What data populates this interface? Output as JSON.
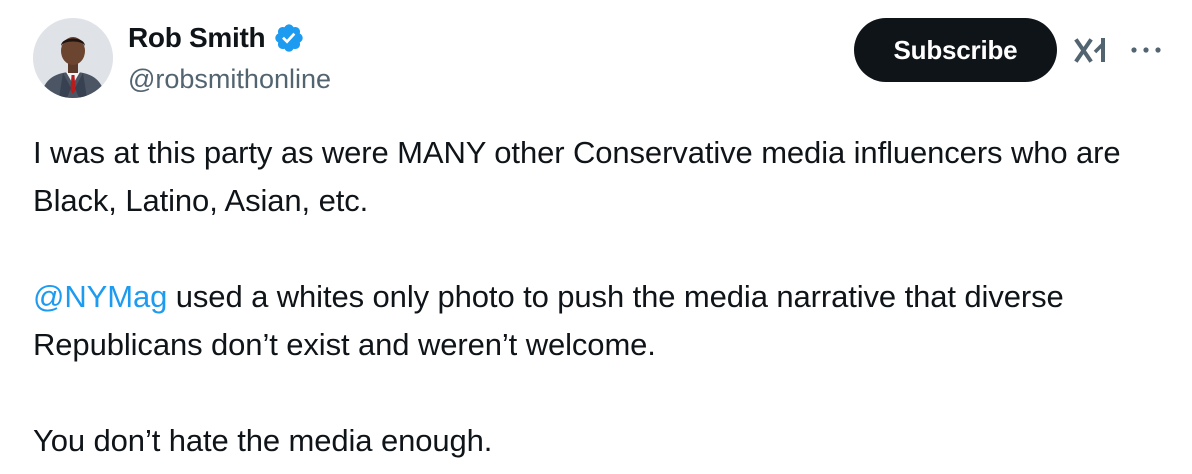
{
  "author": {
    "display_name": "Rob Smith",
    "handle": "@robsmithonline",
    "verified": true,
    "avatar_icon": "profile-photo",
    "verified_icon": "verified-badge-icon",
    "verified_color": "#1d9bf0"
  },
  "actions": {
    "subscribe_label": "Subscribe",
    "grok_icon": "grok-icon",
    "more_icon": "more-options-icon"
  },
  "tweet": {
    "paragraph_1": "I was at this party as were MANY other Conservative media influencers who are Black, Latino, Asian, etc.",
    "mention": "@NYMag",
    "paragraph_2_rest": " used a whites only photo to push the media narrative that diverse Republicans don’t exist and weren’t welcome.",
    "paragraph_3": "You don’t hate the media enough."
  },
  "colors": {
    "text": "#0f1419",
    "secondary_text": "#536471",
    "link": "#1d9bf0",
    "button_bg": "#0f1419",
    "button_text": "#ffffff"
  }
}
